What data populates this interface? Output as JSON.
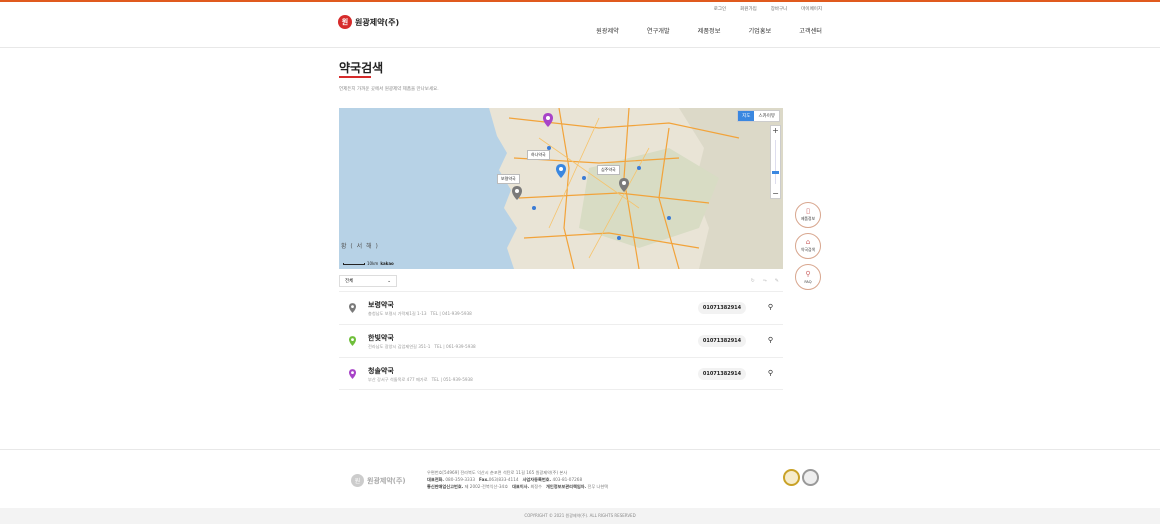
{
  "utility_nav": [
    "로그인",
    "회원가입",
    "장바구니",
    "마이페이지"
  ],
  "logo": {
    "mark": "원",
    "text": "원광제약(주)"
  },
  "gnb": [
    "원광제약",
    "연구개발",
    "제품정보",
    "기업홍보",
    "고객센터"
  ],
  "page": {
    "title": "약국검색",
    "subtitle": "언제든지 가까운 곳에서 원광제약 제품을 만나보세요."
  },
  "map": {
    "type_buttons": [
      "지도",
      "스카이뷰"
    ],
    "active_type": "지도",
    "zoom_in": "+",
    "zoom_out": "−",
    "sea_label": "황 ( 서 해 )",
    "scale_label": "10km",
    "provider": "kakao",
    "labels": [
      "하나약국",
      "심주약국",
      "보령약국"
    ],
    "pin_colors": {
      "gray": "#7a7a7a",
      "green": "#6fbf3b",
      "purple": "#a844c8",
      "blue": "#3a87e0"
    }
  },
  "filter": {
    "selected": "전체"
  },
  "pharmacies": [
    {
      "name": "보령약국",
      "address": "충청남도 보령시 가락제1길 1-13",
      "tel_label": "TEL",
      "tel": "041-939-5938",
      "phone": "01071382914",
      "pin": "gray"
    },
    {
      "name": "한빛약국",
      "address": "전라남도 광양시 김업제연길 351-1",
      "tel_label": "TEL",
      "tel": "061-939-5938",
      "phone": "01071382914",
      "pin": "green"
    },
    {
      "name": "청솔약국",
      "address": "부산 강서구 석돌목로 477 메가로",
      "tel_label": "TEL",
      "tel": "051-939-5938",
      "phone": "01071382914",
      "pin": "purple"
    }
  ],
  "quick_menu": [
    {
      "label": "제품정보",
      "icon": "phone-icon"
    },
    {
      "label": "약국검색",
      "icon": "home-icon"
    },
    {
      "label": "FAQ",
      "icon": "search-icon"
    }
  ],
  "footer": {
    "logo_text": "원광제약(주)",
    "line1": "우편번호[54969]  전라북도 익산시 춘포면 석탄로 11길 165 원광제약(주) 본사",
    "line2_a_label": "대표전화.",
    "line2_a": "080-359-3333",
    "line2_b_label": "Fax.",
    "line2_b": "063)833-4114",
    "line2_c_label": "사업자등록번호.",
    "line2_c": "403-81-07268",
    "line3_a_label": "통신판매업신고번호.",
    "line3_a": "제 2002-전북익산-34호",
    "line3_b_label": "대표이사.",
    "line3_b": "최정수",
    "line3_c_label": "개인정보보관리책임자.",
    "line3_c": "전무 나현택"
  },
  "copyright": "COPYRIGHT © 2021 원광제약(주). ALL RIGHTS RESERVED"
}
